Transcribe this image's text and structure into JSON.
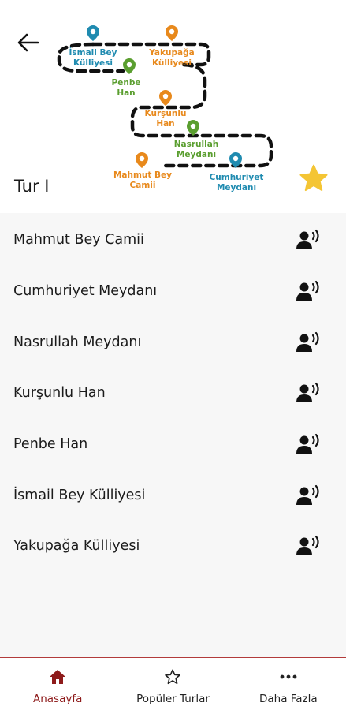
{
  "header": {
    "back_icon": "arrow-left-icon",
    "tour_title": "Tur I",
    "favorite_icon": "star-filled-icon",
    "favorite_color": "#f4c534",
    "route_map": {
      "labels": {
        "ismail_1": "İsmail Bey",
        "ismail_2": "Külliyesi",
        "yakupaga_1": "Yakupağa",
        "yakupaga_2": "Külliyesi",
        "penbe_1": "Penbe",
        "penbe_2": "Han",
        "kursunlu_1": "Kurşunlu",
        "kursunlu_2": "Han",
        "nasrullah_1": "Nasrullah",
        "nasrullah_2": "Meydanı",
        "mahmut_1": "Mahmut Bey",
        "mahmut_2": "Camii",
        "cumhuriyet_1": "Cumhuriyet",
        "cumhuriyet_2": "Meydanı"
      },
      "colors": {
        "blue": "#1f8bb0",
        "orange": "#e8891c",
        "green": "#5a9e2f"
      }
    }
  },
  "stops": [
    {
      "label": "Mahmut Bey Camii",
      "icon": "audio-guide-icon"
    },
    {
      "label": "Cumhuriyet Meydanı",
      "icon": "audio-guide-icon"
    },
    {
      "label": "Nasrullah Meydanı",
      "icon": "audio-guide-icon"
    },
    {
      "label": "Kurşunlu Han",
      "icon": "audio-guide-icon"
    },
    {
      "label": "Penbe Han",
      "icon": "audio-guide-icon"
    },
    {
      "label": "İsmail Bey Külliyesi",
      "icon": "audio-guide-icon"
    },
    {
      "label": "Yakupağa Külliyesi",
      "icon": "audio-guide-icon"
    }
  ],
  "bottom_nav": {
    "items": [
      {
        "label": "Anasayfa",
        "icon": "home-icon",
        "active": true
      },
      {
        "label": "Popüler Turlar",
        "icon": "star-outline-icon",
        "active": false
      },
      {
        "label": "Daha Fazla",
        "icon": "more-dots-icon",
        "active": false
      }
    ],
    "active_color": "#8e1b1b",
    "border_color": "#b23b3b"
  }
}
